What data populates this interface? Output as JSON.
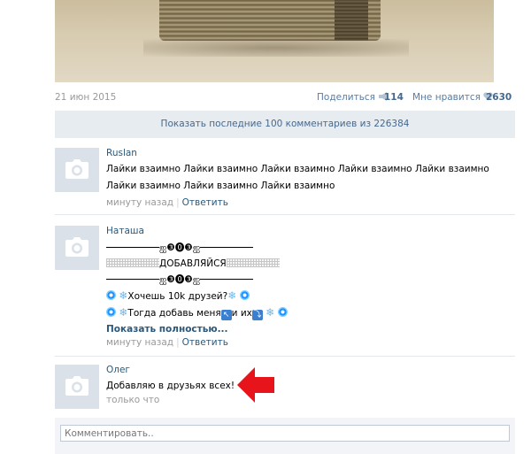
{
  "post": {
    "date": "21 июн 2015",
    "share_label": "Поделиться",
    "share_count": "114",
    "like_label": "Мне нравится",
    "like_count": "2630"
  },
  "show_comments_label": "Показать последние 100 комментариев из 226384",
  "comments": [
    {
      "author": "Ruslan",
      "text": "Лайки взаимно Лайки взаимно Лайки взаимно Лайки взаимно Лайки взаимно Лайки взаимно Лайки взаимно Лайки взаимно",
      "time": "минуту назад",
      "reply": "Ответить"
    },
    {
      "author": "Наташа",
      "line1": "ஐ❸⓿❸ஐ",
      "line2": "ДОБАВЛЯЙСЯ",
      "line3": "ஐ❸⓿❸ஐ",
      "line4": "Хочешь 10k друзей?",
      "line5_a": "Тогда добавь меня",
      "line5_b": "и их",
      "show_full": "Показать полностью...",
      "time": "минуту назад",
      "reply": "Ответить"
    },
    {
      "author": "Олег",
      "text": "Добавляю в друзьях всех!",
      "time": "только что"
    }
  ],
  "comment_input": {
    "placeholder": "Комментировать.."
  },
  "icons": {
    "share": "megaphone-icon",
    "like": "heart-icon",
    "avatar": "camera-icon",
    "pointer": "red-arrow-icon"
  },
  "colors": {
    "link": "#2b587a",
    "meta": "#999999",
    "bar_bg": "#e7ecf1",
    "arrow": "#e8141c"
  }
}
